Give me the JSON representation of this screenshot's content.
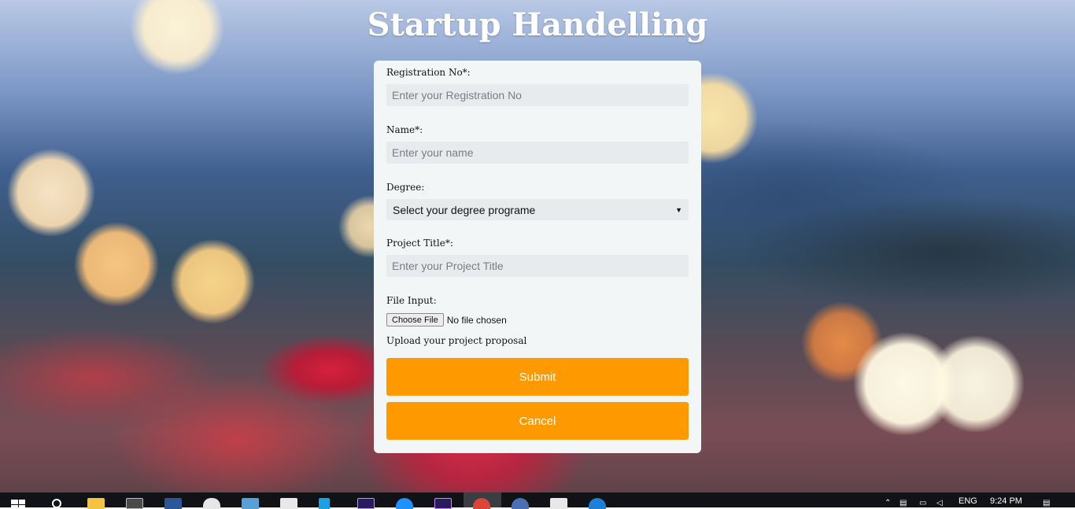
{
  "page": {
    "title": "Startup Handelling"
  },
  "form": {
    "registration": {
      "label": "Registration No*:",
      "placeholder": "Enter your Registration No",
      "value": ""
    },
    "name": {
      "label": "Name*:",
      "placeholder": "Enter your name",
      "value": ""
    },
    "degree": {
      "label": "Degree:",
      "selected": "Select your degree programe"
    },
    "project_title": {
      "label": "Project Title*:",
      "placeholder": "Enter your Project Title",
      "value": ""
    },
    "file_input": {
      "label": "File Input:",
      "button": "Choose File",
      "status": "No file chosen",
      "help": "Upload your project proposal"
    },
    "submit_label": "Submit",
    "cancel_label": "Cancel"
  },
  "colors": {
    "accent": "#ff9900",
    "card_bg": "#f3f6f7",
    "input_bg": "#e8ebed",
    "taskbar": "#101216"
  },
  "taskbar": {
    "apps": [
      {
        "icon": "windows-start-icon"
      },
      {
        "icon": "search-icon"
      },
      {
        "icon": "file-explorer-icon",
        "color": "#f5c242"
      },
      {
        "icon": "terminal-icon",
        "color": "#5a5a5a"
      },
      {
        "icon": "word-icon",
        "color": "#2b579a"
      },
      {
        "icon": "paint-icon",
        "color": "#e8e8e8"
      },
      {
        "icon": "photos-icon",
        "color": "#5aa0d8"
      },
      {
        "icon": "calculator-icon",
        "color": "#e8e8e8"
      },
      {
        "icon": "sway-icon",
        "color": "#1ba1e2"
      },
      {
        "icon": "after-effects-icon",
        "color": "#2a1a5e"
      },
      {
        "icon": "ie-icon",
        "color": "#1e90ff"
      },
      {
        "icon": "premiere-icon",
        "color": "#2a1a5e"
      },
      {
        "icon": "chrome-icon",
        "color": "#db4437"
      },
      {
        "icon": "eagle-app-icon",
        "color": "#4a6fb5"
      },
      {
        "icon": "notepad-icon",
        "color": "#e8e8e8"
      },
      {
        "icon": "edge-icon",
        "color": "#1e7fd8"
      }
    ],
    "language": "ENG",
    "time": "9:24 PM"
  }
}
